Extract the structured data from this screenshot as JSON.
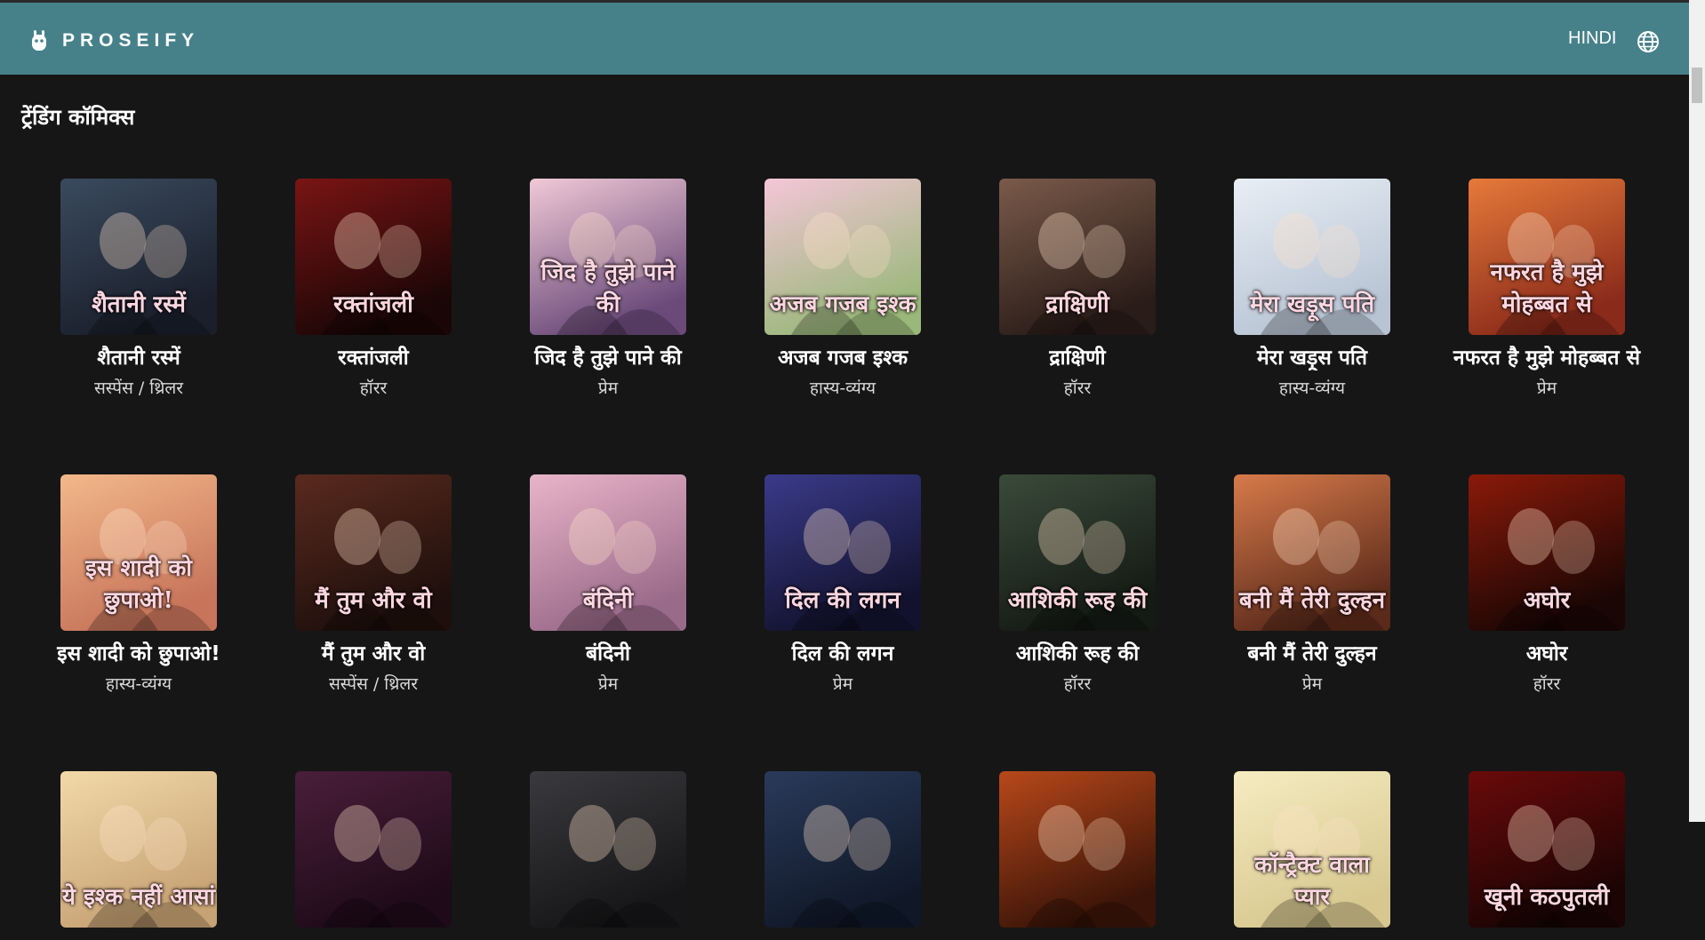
{
  "app": {
    "brand": "PROSEIFY",
    "language": "HINDI"
  },
  "section": {
    "title": "ट्रेंडिंग कॉमिक्स"
  },
  "rows": [
    [
      {
        "title": "शैतानी रस्में",
        "genre": "सस्पेंस / थ्रिलर",
        "cover_text": "शैतानी रस्में",
        "colors": [
          "#3a4a5e",
          "#1a1f2b"
        ]
      },
      {
        "title": "रक्तांजली",
        "genre": "हॉरर",
        "cover_text": "रक्तांजली",
        "colors": [
          "#7a1414",
          "#1a0606"
        ]
      },
      {
        "title": "जिद है तुझे पाने की",
        "genre": "प्रेम",
        "cover_text": "जिद है तुझे पाने की",
        "colors": [
          "#f0c9d6",
          "#6b4a7a"
        ]
      },
      {
        "title": "अजब गजब इश्क",
        "genre": "हास्य-व्यंग्य",
        "cover_text": "अजब गजब इश्क",
        "colors": [
          "#f4c6d8",
          "#9ab87a"
        ]
      },
      {
        "title": "द्राक्षिणी",
        "genre": "हॉरर",
        "cover_text": "द्राक्षिणी",
        "colors": [
          "#7a5a4a",
          "#2a1c18"
        ]
      },
      {
        "title": "मेरा खड़ूस पति",
        "genre": "हास्य-व्यंग्य",
        "cover_text": "मेरा खड़ूस पति",
        "colors": [
          "#e8eef5",
          "#b8c4d4"
        ]
      },
      {
        "title": "नफरत है मुझे मोहब्बत से",
        "genre": "प्रेम",
        "cover_text": "नफरत है मुझे मोहब्बत से",
        "colors": [
          "#e67a3a",
          "#8a2a1a"
        ]
      }
    ],
    [
      {
        "title": "इस शादी को छुपाओ!",
        "genre": "हास्य-व्यंग्य",
        "cover_text": "इस शादी को छुपाओ!",
        "colors": [
          "#f2b88a",
          "#c7745a"
        ]
      },
      {
        "title": "मैं तुम और वो",
        "genre": "सस्पेंस / थ्रिलर",
        "cover_text": "मैं तुम और वो",
        "colors": [
          "#5a2a1e",
          "#1e0f0c"
        ]
      },
      {
        "title": "बंदिनी",
        "genre": "प्रेम",
        "cover_text": "बंदिनी",
        "colors": [
          "#e8b4c8",
          "#9a6a8a"
        ]
      },
      {
        "title": "दिल की लगन",
        "genre": "प्रेम",
        "cover_text": "दिल की लगन",
        "colors": [
          "#3a3a8a",
          "#12122e"
        ]
      },
      {
        "title": "आशिकी रूह की",
        "genre": "हॉरर",
        "cover_text": "आशिकी रूह की",
        "colors": [
          "#3a4a3a",
          "#141a14"
        ]
      },
      {
        "title": "बनी मैं तेरी दुल्हन",
        "genre": "प्रेम",
        "cover_text": "बनी मैं तेरी दुल्हन",
        "colors": [
          "#d87a4a",
          "#5a2a1a"
        ]
      },
      {
        "title": "अघोर",
        "genre": "हॉरर",
        "cover_text": "अघोर",
        "colors": [
          "#8a1a0a",
          "#1a0604"
        ]
      }
    ],
    [
      {
        "title": "",
        "genre": "",
        "cover_text": "ये इश्क नहीं आसां",
        "colors": [
          "#f2d9a8",
          "#c7a274"
        ]
      },
      {
        "title": "",
        "genre": "",
        "cover_text": "",
        "colors": [
          "#4a1e3a",
          "#1e0a18"
        ]
      },
      {
        "title": "",
        "genre": "",
        "cover_text": "",
        "colors": [
          "#3a3a3e",
          "#161618"
        ]
      },
      {
        "title": "",
        "genre": "",
        "cover_text": "",
        "colors": [
          "#2a3a5a",
          "#101828"
        ]
      },
      {
        "title": "",
        "genre": "",
        "cover_text": "",
        "colors": [
          "#b8481a",
          "#3a1408"
        ]
      },
      {
        "title": "",
        "genre": "",
        "cover_text": "कॉन्ट्रैक्ट वाला प्यार",
        "colors": [
          "#f5ecc0",
          "#d8c890"
        ]
      },
      {
        "title": "",
        "genre": "",
        "cover_text": "खूनी कठपुतली",
        "colors": [
          "#6a0a0a",
          "#1a0404"
        ]
      }
    ]
  ]
}
